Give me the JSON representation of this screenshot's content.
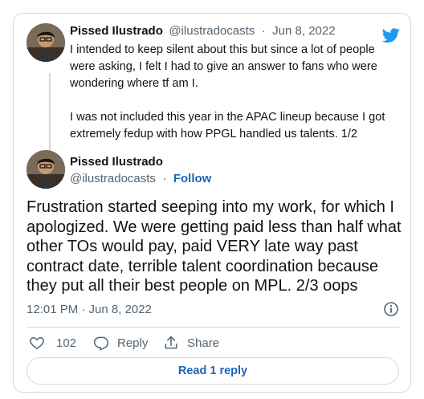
{
  "brand": {
    "accent": "#1d9bf0",
    "link": "#1d64b8",
    "text": "#0f1419",
    "muted": "#536471",
    "border": "#cfd9de"
  },
  "quoted_tweet": {
    "author_name": "Pissed Ilustrado",
    "handle": "@ilustradocasts",
    "date": "Jun 8, 2022",
    "paragraph_1": "I intended to keep silent about this but since a lot of people were asking, I felt I had to give an answer to fans who were wondering where tf am I.",
    "paragraph_2": "I was not included this year in the APAC lineup because I got extremely fedup with how PPGL handled us talents. 1/2"
  },
  "main_tweet": {
    "author_name": "Pissed Ilustrado",
    "handle": "@ilustradocasts",
    "follow_label": "Follow",
    "text": "Frustration started seeping into my work, for which I apologized. We were getting paid less than half what other TOs would pay, paid VERY late way past contract date, terrible talent coordination because they put all their best people on MPL. 2/3 oops",
    "timestamp": "12:01 PM · Jun 8, 2022"
  },
  "actions": {
    "like_count": "102",
    "reply_label": "Reply",
    "share_label": "Share"
  },
  "read_replies_label": "Read 1 reply",
  "icons": [
    "twitter-bird-icon",
    "info-icon",
    "heart-icon",
    "reply-icon",
    "share-icon"
  ]
}
